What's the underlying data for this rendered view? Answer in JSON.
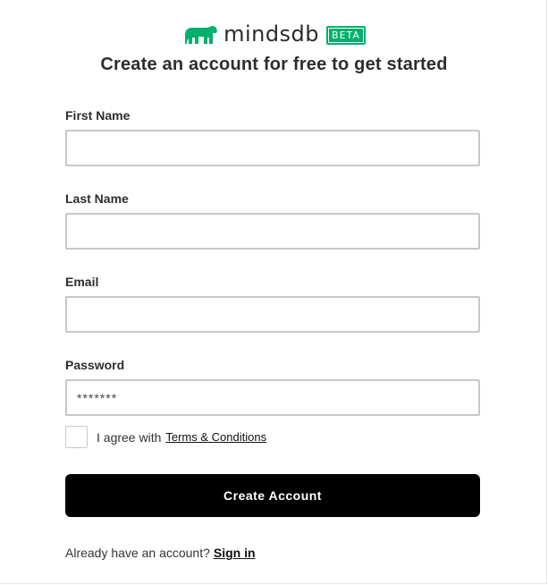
{
  "brand": {
    "name": "mindsdb",
    "badge": "BETA",
    "logo_icon": "bear-logo-icon",
    "accent_color": "#00b06d"
  },
  "page": {
    "title": "Create an account for free to get started"
  },
  "form": {
    "first_name": {
      "label": "First Name",
      "value": "",
      "placeholder": ""
    },
    "last_name": {
      "label": "Last Name",
      "value": "",
      "placeholder": ""
    },
    "email": {
      "label": "Email",
      "value": "",
      "placeholder": ""
    },
    "password": {
      "label": "Password",
      "value": "",
      "placeholder": "*******"
    }
  },
  "agreement": {
    "checked": false,
    "text": "I agree with",
    "link_label": "Terms & Conditions"
  },
  "submit": {
    "label": "Create Account"
  },
  "signin": {
    "prompt": "Already have an account?",
    "link_label": "Sign in"
  }
}
